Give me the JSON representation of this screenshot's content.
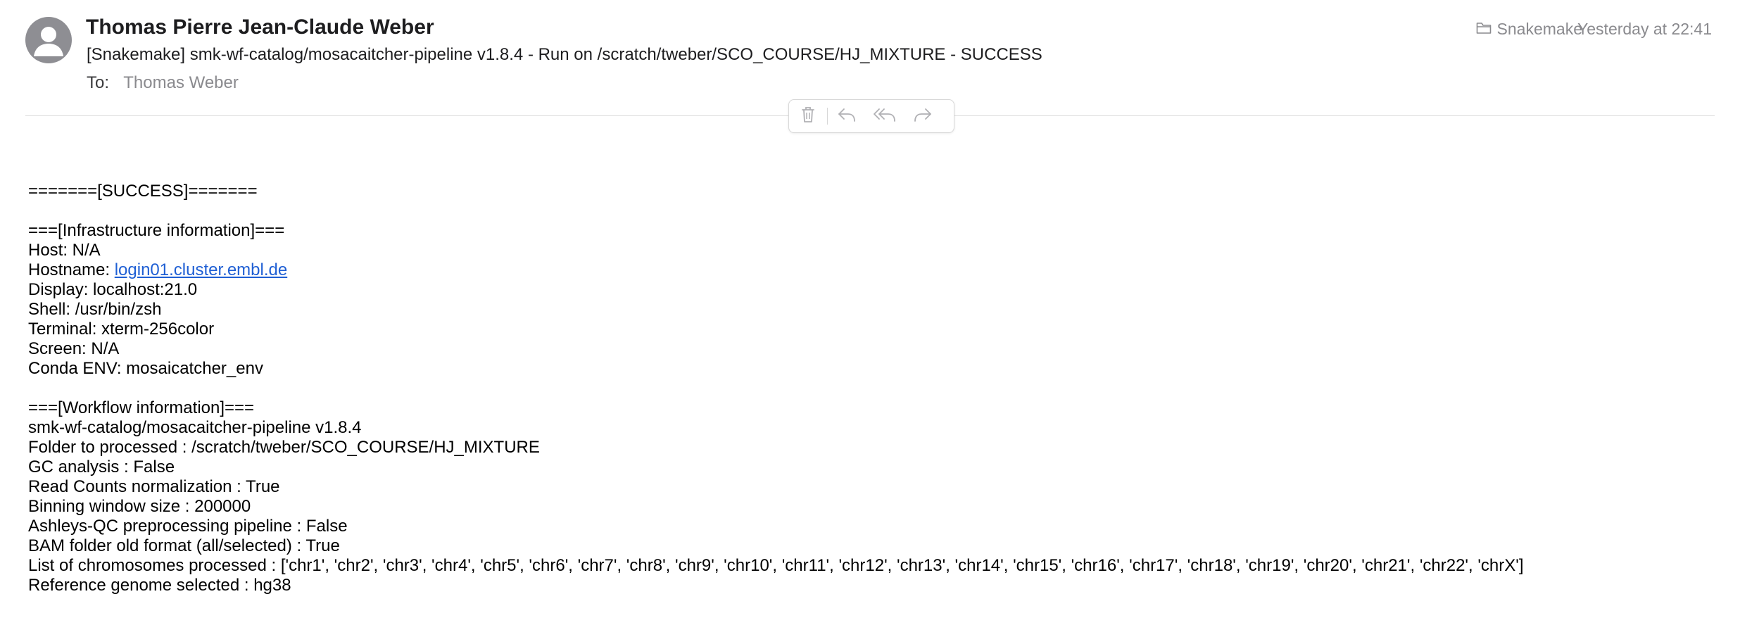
{
  "message": {
    "sender": "Thomas Pierre Jean-Claude Weber",
    "subject": "[Snakemake] smk-wf-catalog/mosacaitcher-pipeline v1.8.4 - Run on /scratch/tweber/SCO_COURSE/HJ_MIXTURE - SUCCESS",
    "to_label": "To:",
    "to_value": "Thomas Weber",
    "mailbox": "Snakemake",
    "date": "Yesterday at 22:41"
  },
  "toolbar": {
    "icons": [
      "trash-icon",
      "reply-icon",
      "reply-all-icon",
      "forward-icon"
    ]
  },
  "body": {
    "status_line": "=======[SUCCESS]=======",
    "infra_header": "===[Infrastructure information]===",
    "host": "Host: N/A",
    "hostname_label": "Hostname: ",
    "hostname_link": "login01.cluster.embl.de",
    "display": "Display: localhost:21.0",
    "shell": "Shell: /usr/bin/zsh",
    "terminal": "Terminal: xterm-256color",
    "screen": "Screen: N/A",
    "conda": "Conda ENV: mosaicatcher_env",
    "workflow_header": "===[Workflow information]===",
    "pipeline": "smk-wf-catalog/mosacaitcher-pipeline v1.8.4",
    "folder": "Folder to processed : /scratch/tweber/SCO_COURSE/HJ_MIXTURE",
    "gc": "GC analysis : False",
    "read_counts": "Read Counts normalization : True",
    "binning": "Binning window size : 200000",
    "ashleys": "Ashleys-QC preprocessing pipeline : False",
    "bam_format": "BAM folder old format (all/selected) : True",
    "chromosomes": "List of chromosomes processed : ['chr1', 'chr2', 'chr3', 'chr4', 'chr5', 'chr6', 'chr7', 'chr8', 'chr9', 'chr10', 'chr11', 'chr12', 'chr13', 'chr14', 'chr15', 'chr16', 'chr17', 'chr18', 'chr19', 'chr20', 'chr21', 'chr22', 'chrX']",
    "reference": "Reference genome selected : hg38"
  }
}
